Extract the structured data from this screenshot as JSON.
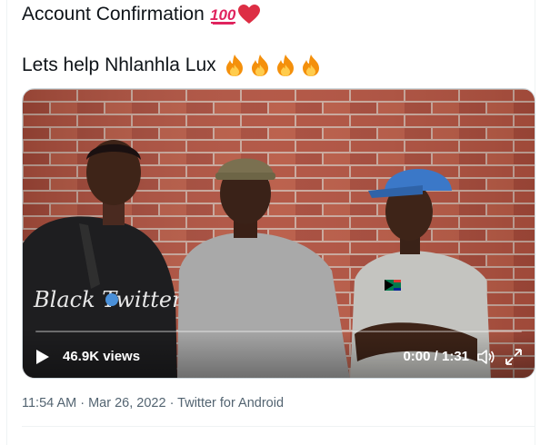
{
  "tweet": {
    "line1": "Account Confirmation",
    "line1_emojis": [
      "hundred-points-emoji",
      "red-heart-emoji"
    ],
    "line2": "Lets help Nhlanhla Lux",
    "line2_emojis": [
      "fire-emoji",
      "fire-emoji",
      "fire-emoji",
      "fire-emoji"
    ]
  },
  "video": {
    "views": "46.9K views",
    "time": "0:00 / 1:31",
    "progress": 0,
    "shirt_text": "Black Twitter"
  },
  "meta": {
    "time": "11:54 AM",
    "sep1": " · ",
    "date": "Mar 26, 2022",
    "sep2": " · ",
    "source": "Twitter for Android"
  },
  "colors": {
    "secondary_text": "#536471",
    "brick": "#b0513f",
    "mortar": "#c9a79b",
    "cap_left": "#7a7050",
    "cap_right": "#3b78c8"
  }
}
